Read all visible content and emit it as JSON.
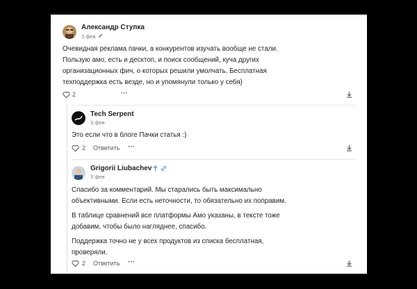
{
  "comments": [
    {
      "author": "Александр Ступка",
      "date": "3 фев",
      "edited_icon": "pencil-icon",
      "lines": [
        "Очевидная реклама пачки, а конкурентов изучать вообще не стали.",
        "Пользую амо, есть и десктоп, и поиск сообщений, куча других",
        "организационных фич, о которых решили умолчать. Бесплатная",
        "техподдержка есть везде, но и упомянули только у себя)"
      ],
      "likes": "2",
      "more": "···"
    },
    {
      "author": "Tech Serpent",
      "date": "3 фев",
      "lines": [
        "Это если что в блоге Пачки статья :)"
      ],
      "likes": "2",
      "reply_label": "Ответить",
      "more": "···"
    },
    {
      "author": "Grigorii Liubachev",
      "date": "3 фев",
      "author_icons": [
        "arrow-up-icon",
        "link-icon"
      ],
      "paragraphs": [
        [
          "Спасибо за комментарий. Мы старались быть максимально",
          "объективными. Если есть неточности, то обязательно их поправим."
        ],
        [
          "В таблице сравнений все платформы Амо указаны, в тексте тоже",
          "добавим, чтобы было нагляднее, спасибо."
        ],
        [
          "Поддержка точно не у всех продуктов из списка бесплатная,",
          "проверяли."
        ]
      ],
      "likes": "2",
      "reply_label": "Ответить",
      "more": "···"
    }
  ],
  "colors": {
    "background": "#000000",
    "card": "#ffffff",
    "link_blue": "#3b7ddd",
    "muted": "#777777"
  }
}
